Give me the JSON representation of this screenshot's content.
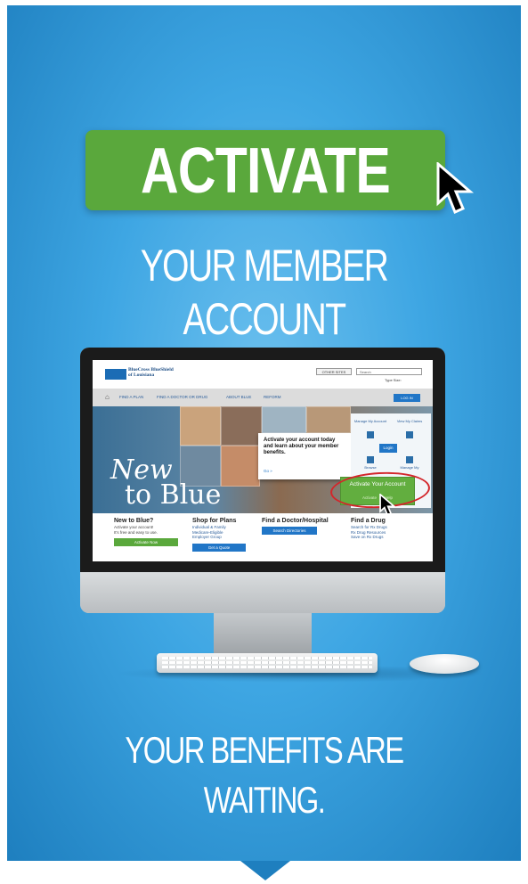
{
  "headline": {
    "title": "ACTIVATE",
    "subtitle": "YOUR MEMBER ACCOUNT"
  },
  "footer": {
    "tagline": "YOUR BENEFITS ARE WAITING."
  },
  "colors": {
    "background": "#3ea6e3",
    "accent_green": "#5aa83c",
    "link_blue": "#2176c7",
    "highlight_red": "#d3262b"
  },
  "website": {
    "brand_line1": "BlueCross BlueShield",
    "brand_line2": "of Louisiana",
    "other_sites": "OTHER SITES",
    "search_placeholder": "Search",
    "type_size": "Type Size:",
    "nav": [
      "FIND A PLAN",
      "FIND A DOCTOR OR DRUG",
      "ABOUT BLUE",
      "REFORM"
    ],
    "login_top": "LOG IN",
    "hero": {
      "new": "New",
      "to_blue": "to Blue"
    },
    "popup": {
      "text": "Activate your account today and learn about your member benefits.",
      "link": "Go »"
    },
    "side": {
      "manage_account": "Manage My Account",
      "view_claims": "View My Claims",
      "login": "Login",
      "browse": "Browse",
      "manage_my": "Manage My"
    },
    "activate_box": {
      "title": "Activate Your Account",
      "link_activate": "Activate",
      "link_help": "Help"
    },
    "columns": [
      {
        "heading": "New to Blue?",
        "lines": [
          "Activate your account!",
          "It's free and easy to use."
        ],
        "button": "Activate Now"
      },
      {
        "heading": "Shop for Plans",
        "lines": [
          "Individual & Family",
          "Medicare-Eligible",
          "Employer Group"
        ],
        "button": "Get a Quote"
      },
      {
        "heading": "Find a Doctor/Hospital",
        "lines": [],
        "button": "Search Directories"
      },
      {
        "heading": "Find a Drug",
        "lines": [
          "Search for Rx Drugs",
          "Rx Drug Resources",
          "Save on Rx Drugs"
        ],
        "button": ""
      }
    ]
  }
}
